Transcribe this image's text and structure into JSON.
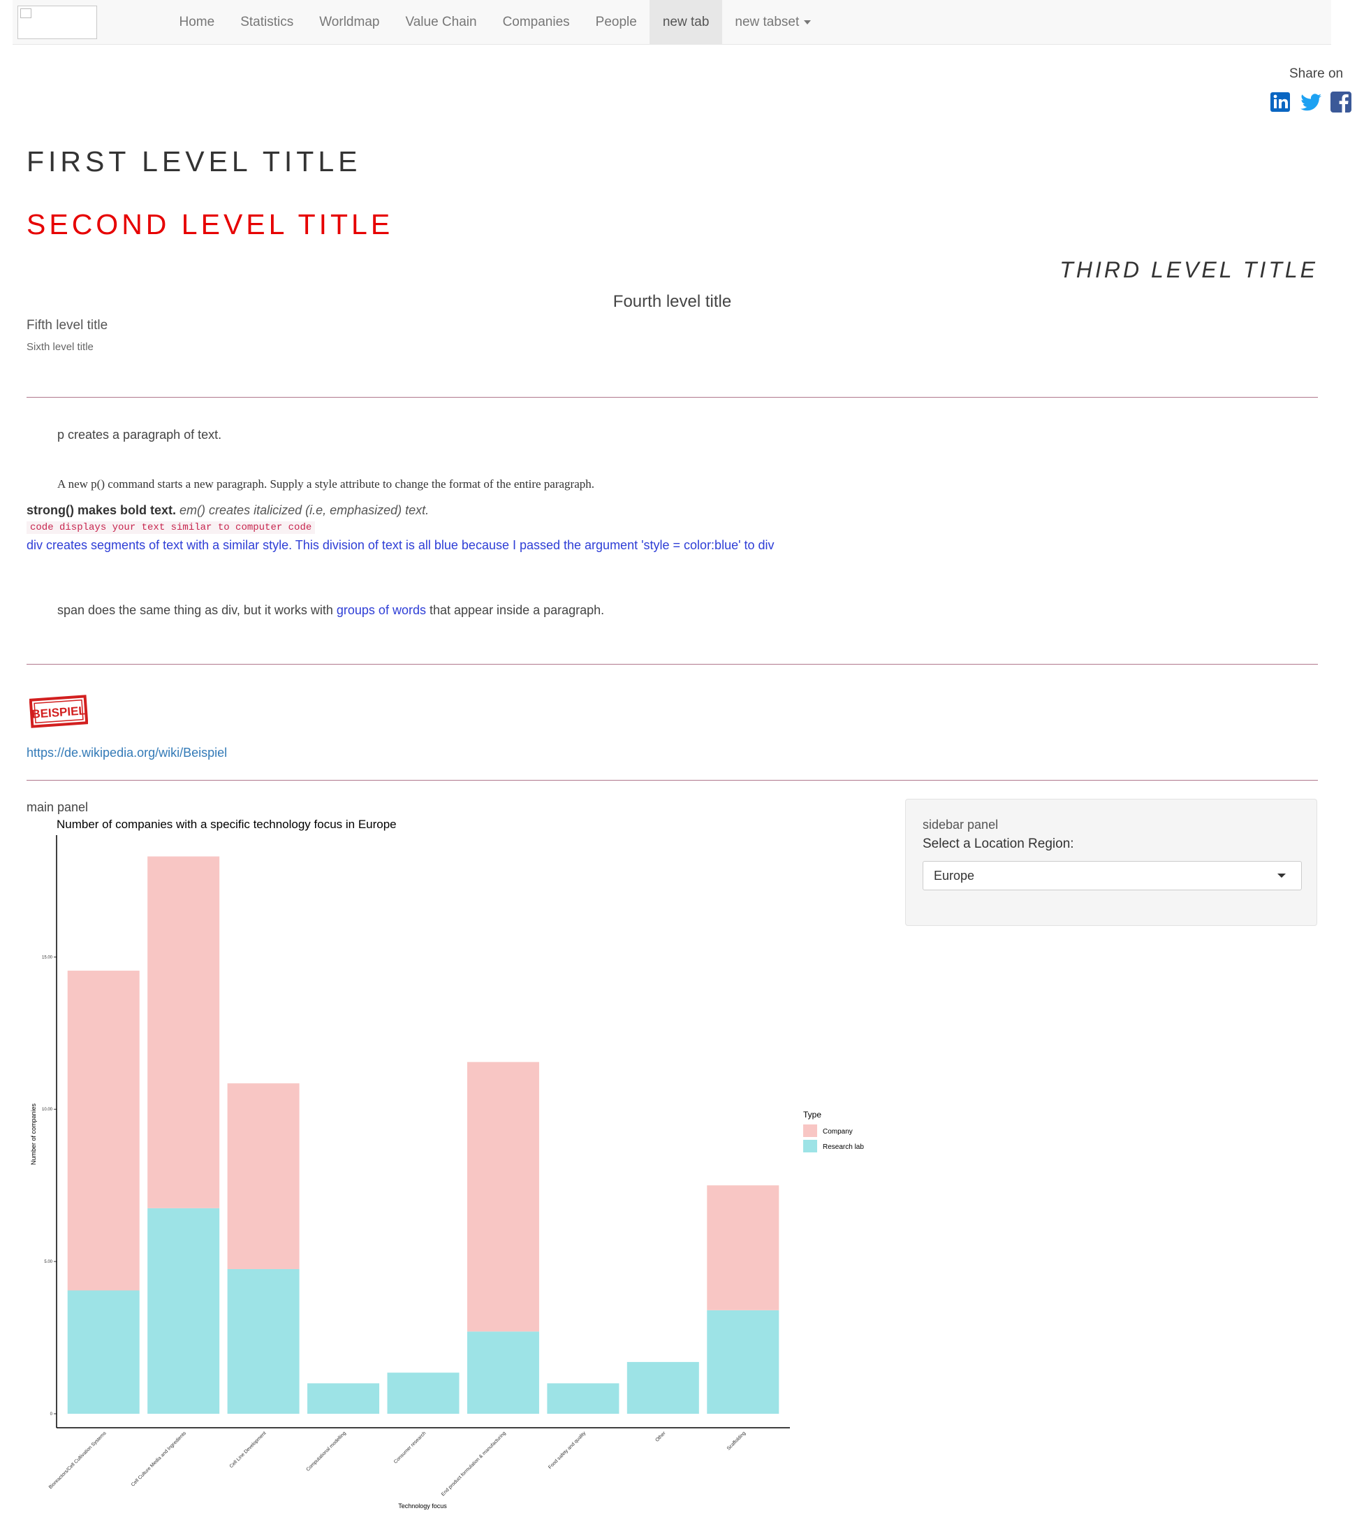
{
  "nav": {
    "items": [
      {
        "label": "Home"
      },
      {
        "label": "Statistics"
      },
      {
        "label": "Worldmap"
      },
      {
        "label": "Value Chain"
      },
      {
        "label": "Companies"
      },
      {
        "label": "People"
      },
      {
        "label": "new tab"
      },
      {
        "label": "new tabset"
      }
    ],
    "active": "new tab"
  },
  "share": {
    "label": "Share on",
    "icons": [
      "linkedin-icon",
      "twitter-icon",
      "facebook-icon"
    ]
  },
  "headings": {
    "h1": "FIRST LEVEL TITLE",
    "h2": "SECOND LEVEL TITLE",
    "h3": "THIRD LEVEL TITLE",
    "h4": "Fourth level title",
    "h5": "Fifth level title",
    "h6": "Sixth level title"
  },
  "text": {
    "p1": "p creates a paragraph of text.",
    "p2": "A new p() command starts a new paragraph. Supply a style attribute to change the format of the entire paragraph.",
    "strong": "strong() makes bold text.",
    "em": "em() creates italicized (i.e, emphasized) text.",
    "code": "code displays your text similar to computer code",
    "div_blue": "div creates segments of text with a similar style. This division of text is all blue because I passed the argument 'style = color:blue' to div",
    "span_before": "span does the same thing as div, but it works with",
    "span_blue": "groups of words",
    "span_after": "that appear inside a paragraph.",
    "stamp": "BEISPIEL",
    "link": "https://de.wikipedia.org/wiki/Beispiel",
    "main_panel": "main panel"
  },
  "sidebar": {
    "label": "sidebar panel",
    "select_label": "Select a Location Region:",
    "selected": "Europe"
  },
  "colors": {
    "company": "#f8c6c4",
    "research": "#9de3e6",
    "title_red": "#e60000",
    "link": "#337ab7",
    "blue_text": "#2e3ed6"
  },
  "chart_data": {
    "type": "bar",
    "stacked": true,
    "title": "Number of companies with a specific technology focus in Europe",
    "xlabel": "Technology focus",
    "ylabel": "Number of companies",
    "categories": [
      "Bioreactors/Cell Cultivation Systems",
      "Cell Culture Media and Ingredients",
      "Cell Line Development",
      "Computational modelling",
      "Consumer research",
      "End product formulation & manufacturing",
      "Food safety and quality",
      "Other",
      "Scaffolding"
    ],
    "series": [
      {
        "name": "Research lab",
        "values": [
          4.05,
          6.75,
          4.75,
          1.0,
          1.35,
          2.7,
          1.0,
          1.7,
          3.4
        ]
      },
      {
        "name": "Company",
        "values": [
          10.5,
          11.55,
          6.1,
          0,
          0,
          8.85,
          0,
          0,
          4.1
        ]
      }
    ],
    "yticks": [
      "0",
      "5.00",
      "10.00",
      "15.00"
    ],
    "ylim": [
      0,
      19
    ],
    "legend": {
      "title": "Type",
      "position": "right"
    }
  }
}
